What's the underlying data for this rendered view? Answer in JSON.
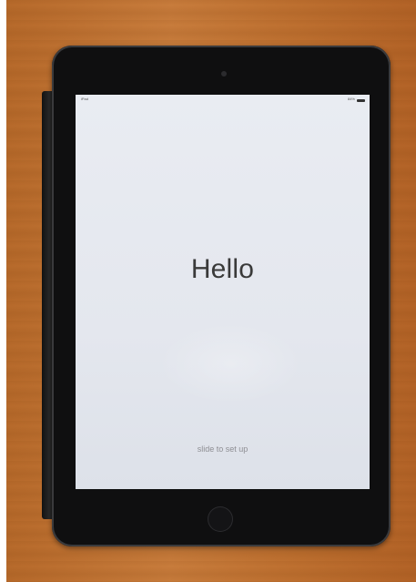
{
  "status_bar": {
    "carrier": "iPad",
    "battery_text": "84%",
    "battery_icon": "battery-icon"
  },
  "screen": {
    "greeting": "Hello",
    "slide_hint": "slide to set up"
  },
  "colors": {
    "wood": "#c87c3c",
    "bezel": "#0f0f10",
    "screen": "#e6e9ef"
  }
}
